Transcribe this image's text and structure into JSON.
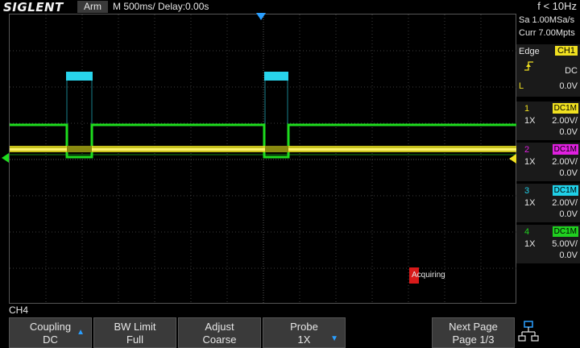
{
  "topbar": {
    "brand": "SIGLENT",
    "status": "Arm",
    "timebase": "M 500ms/  Delay:0.00s",
    "frequency": "f < 10Hz"
  },
  "acquisition": {
    "sample_rate": "Sa 1.00MSa/s",
    "memory": "Curr 7.00Mpts",
    "state": "Acquiring"
  },
  "trigger": {
    "type": "Edge",
    "source": "CH1",
    "coupling": "DC",
    "level_label": "L",
    "level": "0.0V"
  },
  "channels": [
    {
      "num": "1",
      "coupling": "DC1M",
      "probe": "1X",
      "scale": "2.00V/",
      "offset": "0.0V",
      "color": "#f0e020"
    },
    {
      "num": "2",
      "coupling": "DC1M",
      "probe": "1X",
      "scale": "2.00V/",
      "offset": "0.0V",
      "color": "#e020e0"
    },
    {
      "num": "3",
      "coupling": "DC1M",
      "probe": "1X",
      "scale": "2.00V/",
      "offset": "0.0V",
      "color": "#20d0e8"
    },
    {
      "num": "4",
      "coupling": "DC1M",
      "probe": "1X",
      "scale": "5.00V/",
      "offset": "0.0V",
      "color": "#20d020"
    }
  ],
  "menu": {
    "title": "CH4",
    "softkeys": [
      {
        "line1": "Coupling",
        "line2": "DC",
        "arrow": "up"
      },
      {
        "line1": "BW Limit",
        "line2": "Full",
        "arrow": ""
      },
      {
        "line1": "Adjust",
        "line2": "Coarse",
        "arrow": ""
      },
      {
        "line1": "Probe",
        "line2": "1X",
        "arrow": "down"
      },
      {
        "line1": "",
        "line2": "",
        "arrow": ""
      },
      {
        "line1": "Next Page",
        "line2": "Page 1/3",
        "arrow": ""
      }
    ]
  },
  "icons": {
    "trigger_edge": "rising-edge-icon",
    "network": "network-icon",
    "trigger_position": "trigger-position-marker-icon"
  }
}
